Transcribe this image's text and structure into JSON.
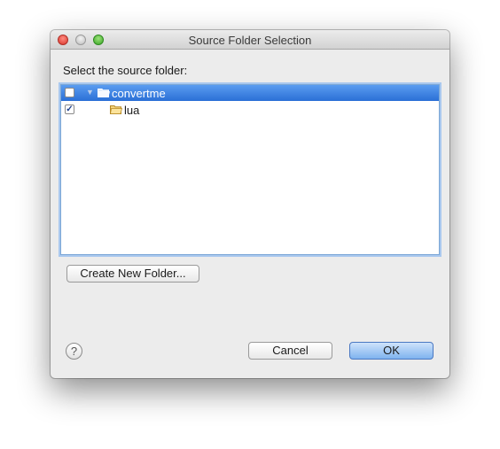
{
  "window": {
    "title": "Source Folder Selection"
  },
  "dialog": {
    "prompt": "Select the source folder:",
    "tree": [
      {
        "label": "convertme",
        "checked": false,
        "expanded": true,
        "selected": true,
        "icon": "folder-open-icon"
      },
      {
        "label": "lua",
        "checked": true,
        "selected": false,
        "icon": "folder-icon"
      }
    ],
    "create_folder_label": "Create New Folder...",
    "help_symbol": "?",
    "cancel_label": "Cancel",
    "ok_label": "OK"
  },
  "colors": {
    "selection": "#3b80e0",
    "default_button": "#8fbcef",
    "focus_ring": "#a9c8ee"
  }
}
